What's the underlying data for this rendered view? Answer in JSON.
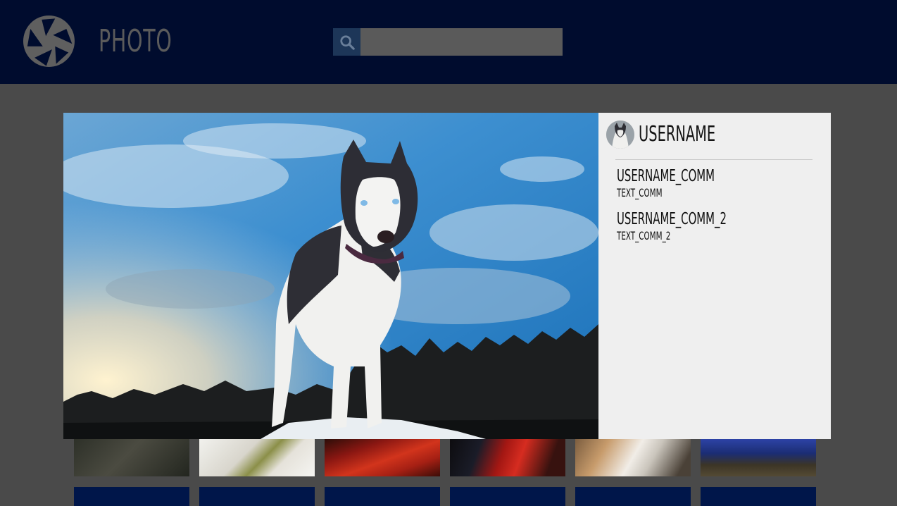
{
  "header": {
    "brand": "PHOTO",
    "logo_icon": "camera-aperture-icon",
    "search_icon": "search-icon",
    "search_value": "",
    "search_placeholder": ""
  },
  "modal": {
    "image_alt": "Siberian husky standing on snow under a blue sky",
    "username": "USERNAME",
    "comments": [
      {
        "user": "USERNAME_COMM",
        "text": "TEXT_COMM"
      },
      {
        "user": "USERNAME_COMM_2",
        "text": "TEXT_COMM_2"
      }
    ]
  },
  "colors": {
    "header_bg": "#000c2e",
    "page_bg": "#4a4a4a",
    "panel_bg": "#efefef",
    "search_btn": "#1d3658",
    "tile_blue": "#00164a"
  }
}
